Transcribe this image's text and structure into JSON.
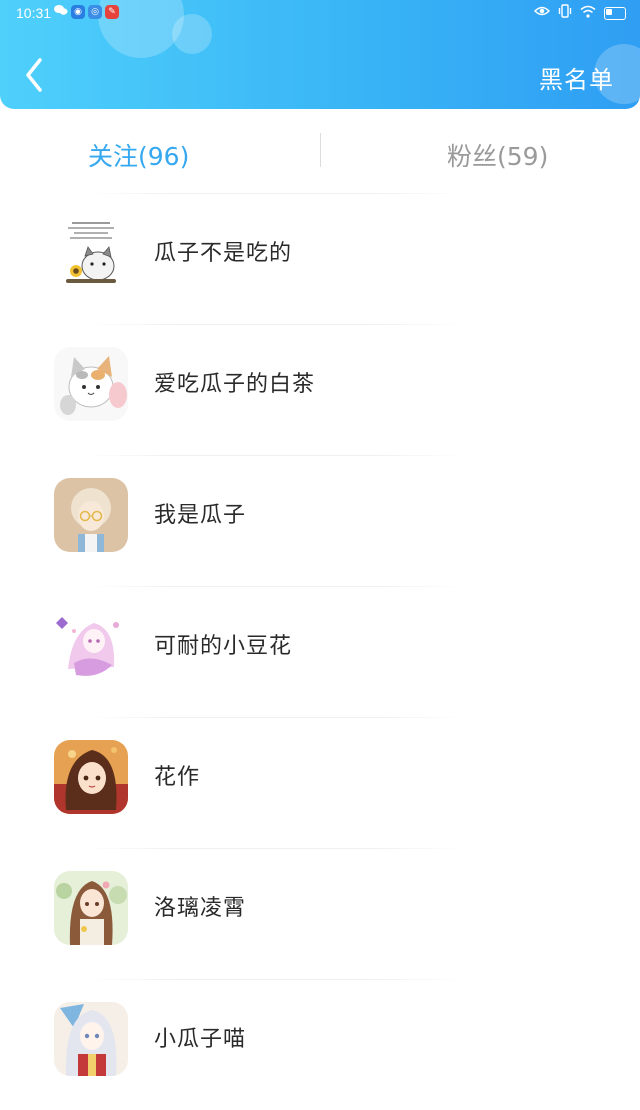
{
  "status": {
    "time": "10:31"
  },
  "header": {
    "blacklist_label": "黑名单"
  },
  "tabs": [
    {
      "label": "关注(96)",
      "active": true
    },
    {
      "label": "粉丝(59)",
      "active": false
    }
  ],
  "list": [
    {
      "name": "瓜子不是吃的",
      "avatar": "cat-with-seeds-avatar"
    },
    {
      "name": "爱吃瓜子的白茶",
      "avatar": "cat-avatar"
    },
    {
      "name": "我是瓜子",
      "avatar": "glasses-girl-avatar"
    },
    {
      "name": "可耐的小豆花",
      "avatar": "pink-anime-girl-avatar"
    },
    {
      "name": "花作",
      "avatar": "brown-hair-girl-avatar"
    },
    {
      "name": "洛璃凌霄",
      "avatar": "flower-girl-avatar"
    },
    {
      "name": "小瓜子喵",
      "avatar": "silver-hair-girl-avatar"
    }
  ],
  "colors": {
    "header_start": "#4fd0fb",
    "header_end": "#2f9ef3",
    "tab_active": "#35a8ef",
    "tab_inactive": "#9a9a9a"
  }
}
